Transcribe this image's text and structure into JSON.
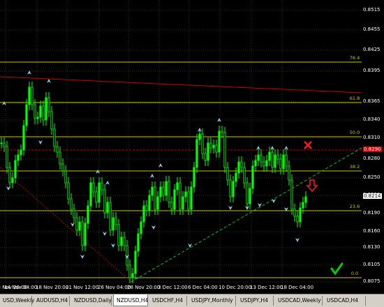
{
  "chart": {
    "symbol": "NZDUSD",
    "timeframe": "H4",
    "colors": {
      "background": "#000000",
      "grid": "#2e2e2e",
      "candle": "#00ff00",
      "fib": "#c8c800",
      "resistance": "#cc0000",
      "support_trend": "#00c800",
      "dotted_trend": "#c00000",
      "fractal": "#87ceeb",
      "bid_label": "#e00000",
      "check": "#00cc00"
    },
    "price_labels": [
      "0.8515",
      "0.8455",
      "0.8425",
      "0.8395",
      "0.8365",
      "0.8340",
      "0.8310",
      "0.8280",
      "0.8250",
      "0.8220",
      "0.8190",
      "0.8160",
      "0.8130",
      "0.8105",
      "0.8075"
    ],
    "current_price_label": "0.8214",
    "highlight_price_label": "0.8290",
    "time_labels": [
      "13 Nov 20:00",
      "14 Nov 04:00",
      "18 Nov 20:00",
      "21 Nov 12:00",
      "26 Nov 04:00",
      "28 Nov 20:00",
      "3 Dec 12:00",
      "6 Dec 04:00",
      "10 Dec 20:00",
      "13 Dec 12:00",
      "18 Dec 04:00"
    ],
    "fib_levels": [
      "76.4",
      "61.8",
      "50.0",
      "38.2",
      "23.6",
      "0.0"
    ],
    "markers": {
      "cross_icon": "x-mark-icon",
      "arrow_icon": "down-arrow-icon",
      "check_icon": "checkmark-icon"
    }
  },
  "tabs": [
    {
      "label": "USD,Weekly",
      "active": false
    },
    {
      "label": "AUDUSD,H4",
      "active": false
    },
    {
      "label": "NZDUSD,Daily",
      "active": false
    },
    {
      "label": "NZDUSD,H4",
      "active": true
    },
    {
      "label": "USDCHF,H4",
      "active": false
    },
    {
      "label": "USDJPY,Monthly",
      "active": false
    },
    {
      "label": "USDJPY,H4",
      "active": false
    },
    {
      "label": "USDCAD,Weekly",
      "active": false
    },
    {
      "label": "USDCAD,H4",
      "active": false
    }
  ]
}
